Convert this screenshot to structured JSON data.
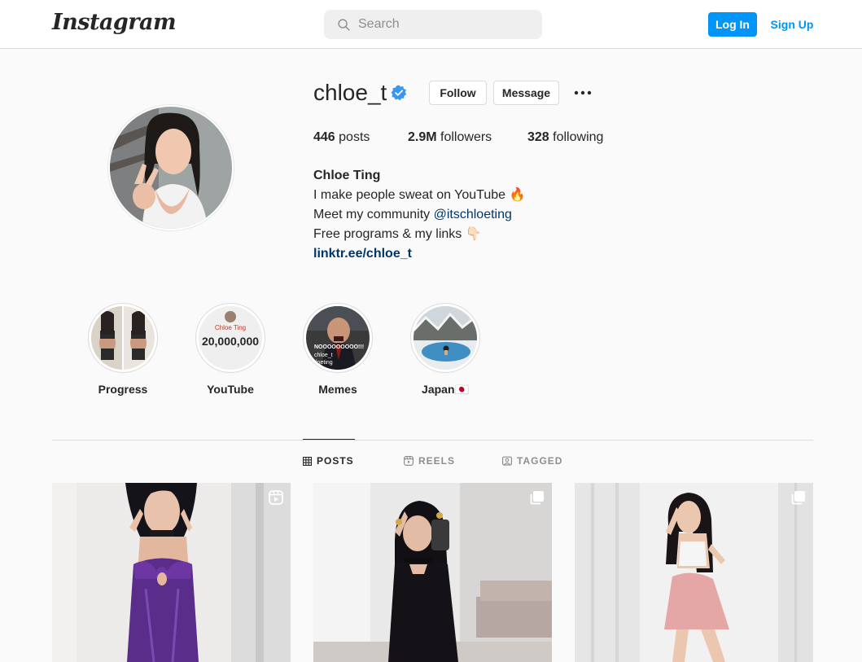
{
  "nav": {
    "logo": "Instagram",
    "search_placeholder": "Search",
    "search_value": "",
    "login_label": "Log In",
    "signup_label": "Sign Up"
  },
  "profile": {
    "username": "chloe_t",
    "follow_label": "Follow",
    "message_label": "Message",
    "stats": {
      "posts_count": "446",
      "posts_label": "posts",
      "followers_count": "2.9M",
      "followers_label": "followers",
      "following_count": "328",
      "following_label": "following"
    },
    "bio": {
      "name": "Chloe Ting",
      "line1": "I make people sweat on YouTube 🔥",
      "line2_prefix": "Meet my community ",
      "line2_mention": "@itschloeting",
      "line3": "Free programs & my links 👇🏻",
      "link": "linktr.ee/chloe_t"
    }
  },
  "highlights": [
    {
      "label": "Progress"
    },
    {
      "label": "YouTube",
      "cover_name": "Chloe Ting",
      "cover_count": "20,000,000"
    },
    {
      "label": "Memes",
      "cover_text": "NOOOOOOOOO!!!",
      "cover_tag1": "chloe_t",
      "cover_tag2": "loeting"
    },
    {
      "label": "Japan🇯🇵"
    }
  ],
  "tabs": [
    {
      "label": "POSTS",
      "active": true
    },
    {
      "label": "REELS",
      "active": false
    },
    {
      "label": "TAGGED",
      "active": false
    }
  ],
  "posts": [
    {
      "type": "reel",
      "badge_icon": "reels-badge-icon"
    },
    {
      "type": "carousel",
      "badge_icon": "carousel-badge-icon"
    },
    {
      "type": "carousel",
      "badge_icon": "carousel-badge-icon"
    }
  ],
  "colors": {
    "accent": "#0095f6",
    "verified": "#3897f0",
    "link": "#00376b",
    "text": "#262626",
    "muted": "#8e8e8e",
    "border": "#dbdbdb",
    "background": "#fafafa"
  }
}
